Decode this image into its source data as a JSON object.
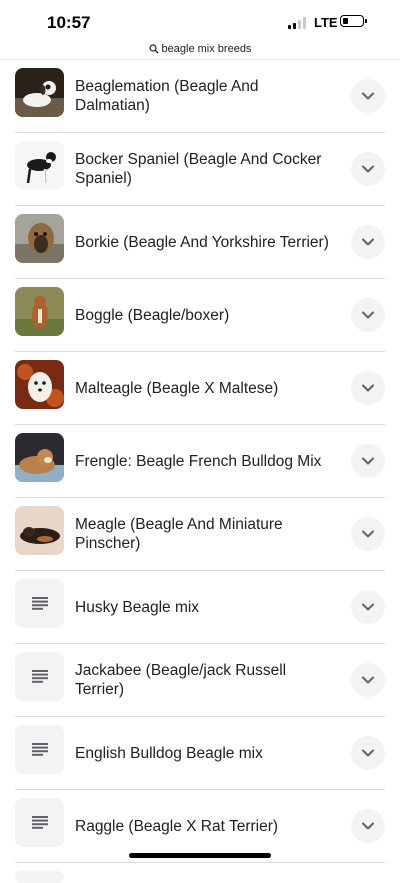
{
  "status": {
    "time": "10:57",
    "network": "LTE"
  },
  "url_bar": {
    "query": "beagle mix breeds",
    "icon": "search-icon"
  },
  "items": [
    {
      "label": "Beaglemation (Beagle And Dalmatian)",
      "thumb": "photo",
      "icon": "chevron-down-icon"
    },
    {
      "label": "Bocker Spaniel (Beagle And Cocker Spaniel)",
      "thumb": "photo",
      "icon": "chevron-down-icon"
    },
    {
      "label": "Borkie (Beagle And Yorkshire Terrier)",
      "thumb": "photo",
      "icon": "chevron-down-icon"
    },
    {
      "label": "Boggle (Beagle/boxer)",
      "thumb": "photo",
      "icon": "chevron-down-icon"
    },
    {
      "label": "Malteagle (Beagle X Maltese)",
      "thumb": "photo",
      "icon": "chevron-down-icon"
    },
    {
      "label": "Frengle: Beagle French Bulldog Mix",
      "thumb": "photo",
      "icon": "chevron-down-icon"
    },
    {
      "label": "Meagle (Beagle And Miniature Pinscher)",
      "thumb": "photo",
      "icon": "chevron-down-icon"
    },
    {
      "label": "Husky Beagle mix",
      "thumb": "document-icon",
      "icon": "chevron-down-icon"
    },
    {
      "label": "Jackabee (Beagle/jack Russell Terrier)",
      "thumb": "document-icon",
      "icon": "chevron-down-icon"
    },
    {
      "label": "English Bulldog Beagle mix",
      "thumb": "document-icon",
      "icon": "chevron-down-icon"
    },
    {
      "label": "Raggle (Beagle X Rat Terrier)",
      "thumb": "document-icon",
      "icon": "chevron-down-icon"
    }
  ]
}
